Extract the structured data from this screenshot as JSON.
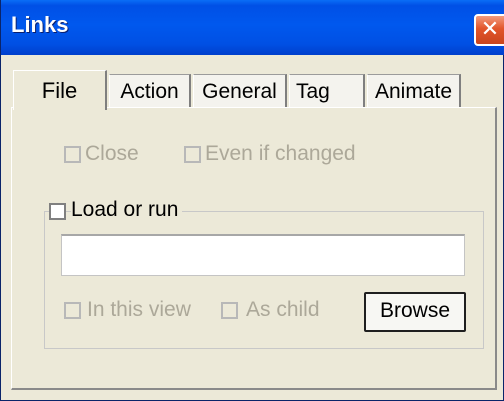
{
  "window": {
    "title": "Links",
    "close_glyph": "✕"
  },
  "tabs": [
    {
      "label": "File",
      "active": true
    },
    {
      "label": "Action",
      "active": false
    },
    {
      "label": "General",
      "active": false
    },
    {
      "label": "Tag",
      "active": false
    },
    {
      "label": "Animate",
      "active": false
    }
  ],
  "file_tab": {
    "close": {
      "label": "Close",
      "checked": false,
      "enabled": false
    },
    "even_if_changed": {
      "label": "Even if changed",
      "checked": false,
      "enabled": false
    },
    "load_or_run": {
      "label": "Load or run",
      "checked": false,
      "enabled": true
    },
    "path_value": "",
    "in_this_view": {
      "label": "In this view",
      "checked": false,
      "enabled": false
    },
    "as_child": {
      "label": "As child",
      "checked": false,
      "enabled": false
    },
    "browse_label": "Browse"
  },
  "colors": {
    "titlebar": "#0058ee",
    "dialog_bg": "#ece9d8",
    "disabled_text": "#aca899",
    "close_button": "#e2552a"
  }
}
